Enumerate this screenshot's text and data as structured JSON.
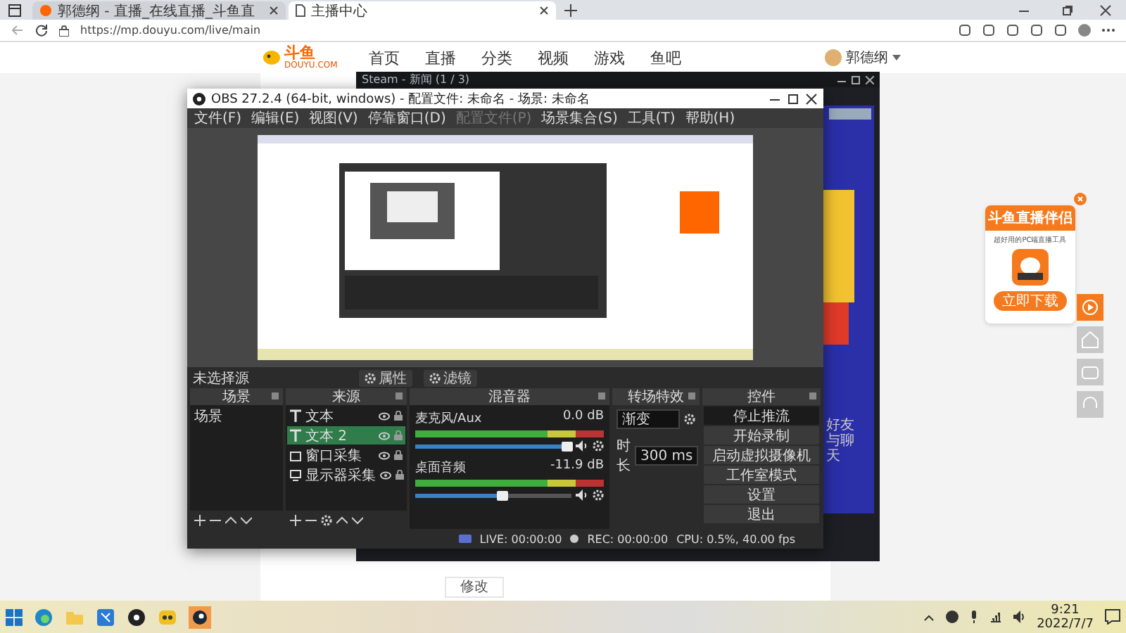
{
  "browser": {
    "tabs": [
      {
        "title": "郭德纲 - 直播_在线直播_斗鱼直",
        "selected": false
      },
      {
        "title": "主播中心",
        "selected": true
      }
    ],
    "url": "https://mp.douyu.com/live/main"
  },
  "site": {
    "logo": "斗鱼",
    "logo_sub": "DOUYU.COM",
    "nav": [
      "首页",
      "直播",
      "分类",
      "视频",
      "游戏",
      "鱼吧"
    ],
    "user": "郭德纲"
  },
  "steam_window": {
    "title": "Steam - 新闻 (1 / 3)",
    "friends": "好友与聊天"
  },
  "obs": {
    "title": "OBS 27.2.4 (64-bit, windows) - 配置文件: 未命名 - 场景: 未命名",
    "menu": [
      {
        "label": "文件(F)",
        "disabled": false
      },
      {
        "label": "编辑(E)",
        "disabled": false
      },
      {
        "label": "视图(V)",
        "disabled": false
      },
      {
        "label": "停靠窗口(D)",
        "disabled": false
      },
      {
        "label": "配置文件(P)",
        "disabled": true
      },
      {
        "label": "场景集合(S)",
        "disabled": false
      },
      {
        "label": "工具(T)",
        "disabled": false
      },
      {
        "label": "帮助(H)",
        "disabled": false
      }
    ],
    "source_status": "未选择源",
    "source_buttons": [
      "属性",
      "滤镜"
    ],
    "scenes": {
      "title": "场景",
      "items": [
        {
          "label": "场景",
          "selected": false
        }
      ]
    },
    "sources": {
      "title": "来源",
      "items": [
        {
          "label": "文本",
          "kind": "text",
          "selected": false
        },
        {
          "label": "文本 2",
          "kind": "text",
          "selected": true
        },
        {
          "label": "窗口采集",
          "kind": "window",
          "selected": false
        },
        {
          "label": "显示器采集",
          "kind": "display",
          "selected": false
        }
      ]
    },
    "mixer": {
      "title": "混音器",
      "channels": [
        {
          "name": "麦克风/Aux",
          "reading": "0.0 dB",
          "level": 0.97
        },
        {
          "name": "桌面音频",
          "reading": "-11.9 dB",
          "level": 0.56
        }
      ]
    },
    "transitions": {
      "title": "转场特效",
      "type": "渐变",
      "duration_label": "时长",
      "duration": "300 ms"
    },
    "controls": {
      "title": "控件",
      "buttons": [
        {
          "label": "停止推流",
          "active": true
        },
        {
          "label": "开始录制",
          "active": false
        },
        {
          "label": "启动虚拟摄像机",
          "active": false
        },
        {
          "label": "工作室模式",
          "active": false
        },
        {
          "label": "设置",
          "active": false
        },
        {
          "label": "退出",
          "active": false
        }
      ]
    },
    "status": {
      "live": "LIVE: 00:00:00",
      "rec": "REC: 00:00:00",
      "cpu": "CPU: 0.5%, 40.00 fps"
    }
  },
  "ad": {
    "title": "斗鱼直播伴侣",
    "subtitle": "超好用的PC端直播工具",
    "button": "立即下载"
  },
  "page": {
    "edit_button": "修改"
  },
  "taskbar": {
    "time": "9:21",
    "date": "2022/7/7"
  }
}
